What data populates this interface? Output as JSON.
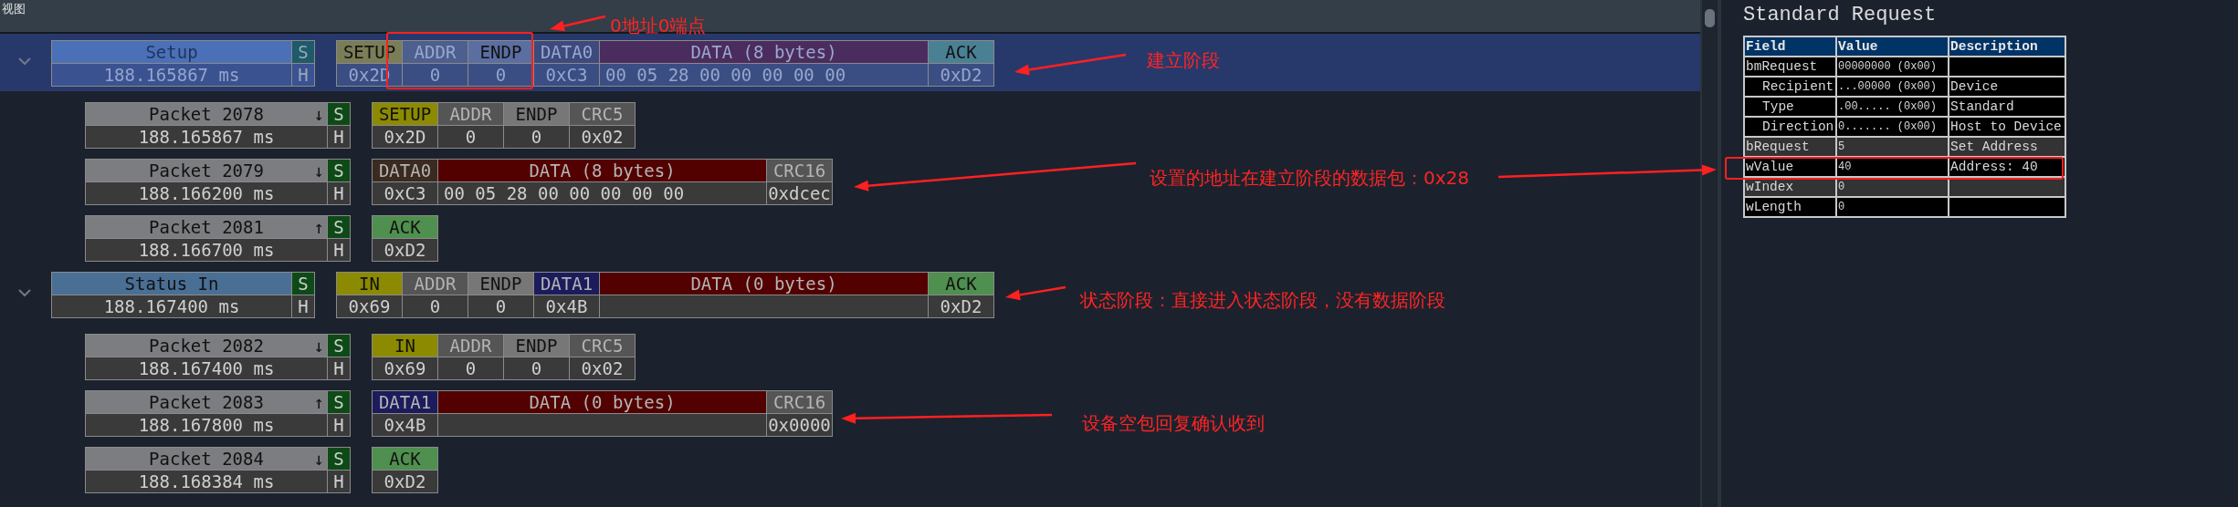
{
  "title_bar": {
    "title": "视图"
  },
  "transactions": [
    {
      "name": "Setup",
      "time": "188.165867 ms",
      "flag_top": "S",
      "flag_bottom": "H",
      "selected": true,
      "expanded": true,
      "fields": [
        {
          "label": "SETUP",
          "value": "0x2D",
          "kind": "pid",
          "color": "#7b7d57"
        },
        {
          "label": "ADDR",
          "value": "0",
          "kind": "addr",
          "color": "#4d5f8e"
        },
        {
          "label": "ENDP",
          "value": "0",
          "kind": "endp",
          "color": "#5b6ea2"
        },
        {
          "label": "DATA0",
          "value": "0xC3",
          "kind": "pid",
          "color": "#3d4a7e"
        },
        {
          "label": "DATA (8 bytes)",
          "value": "00 05 28 00 00 00 00 00",
          "kind": "data",
          "color": "#4b2c5f"
        },
        {
          "label": "ACK",
          "value": "0xD2",
          "kind": "pid",
          "color": "#4a8094"
        }
      ],
      "packets": [
        {
          "name": "Packet 2078",
          "direction": "↓",
          "time": "188.165867 ms",
          "flag_top": "S",
          "flag_bottom": "H",
          "fields": [
            {
              "label": "SETUP",
              "value": "0x2D",
              "kind": "pid",
              "color": "#8c8a00"
            },
            {
              "label": "ADDR",
              "value": "0",
              "kind": "addr",
              "color": "#555555"
            },
            {
              "label": "ENDP",
              "value": "0",
              "kind": "endp",
              "color": "#777777"
            },
            {
              "label": "CRC5",
              "value": "0x02",
              "kind": "crc",
              "color": "#555555"
            }
          ]
        },
        {
          "name": "Packet 2079",
          "direction": "↓",
          "time": "188.166200 ms",
          "flag_top": "S",
          "flag_bottom": "H",
          "fields": [
            {
              "label": "DATA0",
              "value": "0xC3",
              "kind": "pid",
              "color": "#3b2a20"
            },
            {
              "label": "DATA (8 bytes)",
              "value": "00 05 28 00 00 00 00 00",
              "kind": "data",
              "color": "#520000"
            },
            {
              "label": "CRC16",
              "value": "0xdcec",
              "kind": "crc",
              "color": "#555555"
            }
          ]
        },
        {
          "name": "Packet 2081",
          "direction": "↑",
          "time": "188.166700 ms",
          "flag_top": "S",
          "flag_bottom": "H",
          "fields": [
            {
              "label": "ACK",
              "value": "0xD2",
              "kind": "pid",
              "color": "#4f8f4f"
            }
          ]
        }
      ]
    },
    {
      "name": "Status In",
      "time": "188.167400 ms",
      "flag_top": "S",
      "flag_bottom": "H",
      "selected": false,
      "expanded": true,
      "fields": [
        {
          "label": "IN",
          "value": "0x69",
          "kind": "pid",
          "color": "#8c8a00"
        },
        {
          "label": "ADDR",
          "value": "0",
          "kind": "addr",
          "color": "#555555"
        },
        {
          "label": "ENDP",
          "value": "0",
          "kind": "endp",
          "color": "#777777"
        },
        {
          "label": "DATA1",
          "value": "0x4B",
          "kind": "pid",
          "color": "#1c1c5c"
        },
        {
          "label": "DATA (0 bytes)",
          "kind": "data",
          "color": "#520000"
        },
        {
          "label": "ACK",
          "value": "0xD2",
          "kind": "pid",
          "color": "#4f8f4f"
        }
      ],
      "packets": [
        {
          "name": "Packet 2082",
          "direction": "↓",
          "time": "188.167400 ms",
          "flag_top": "S",
          "flag_bottom": "H",
          "fields": [
            {
              "label": "IN",
              "value": "0x69",
              "kind": "pid",
              "color": "#8c8a00"
            },
            {
              "label": "ADDR",
              "value": "0",
              "kind": "addr",
              "color": "#555555"
            },
            {
              "label": "ENDP",
              "value": "0",
              "kind": "endp",
              "color": "#777777"
            },
            {
              "label": "CRC5",
              "value": "0x02",
              "kind": "crc",
              "color": "#555555"
            }
          ]
        },
        {
          "name": "Packet 2083",
          "direction": "↑",
          "time": "188.167800 ms",
          "flag_top": "S",
          "flag_bottom": "H",
          "fields": [
            {
              "label": "DATA1",
              "value": "0x4B",
              "kind": "pid",
              "color": "#1c1c5c"
            },
            {
              "label": "DATA (0 bytes)",
              "kind": "data",
              "color": "#520000"
            },
            {
              "label": "CRC16",
              "value": "0x0000",
              "kind": "crc",
              "color": "#555555"
            }
          ]
        },
        {
          "name": "Packet 2084",
          "direction": "↓",
          "time": "188.168384 ms",
          "flag_top": "S",
          "flag_bottom": "H",
          "fields": [
            {
              "label": "ACK",
              "value": "0xD2",
              "kind": "pid",
              "color": "#4f8f4f"
            }
          ]
        }
      ]
    }
  ],
  "details": {
    "title": "Standard Request",
    "columns": [
      "Field",
      "Value",
      "Description"
    ],
    "rows": [
      {
        "field": "bmRequest",
        "value": "00000000 (0x00)",
        "children": [
          {
            "field": "Recipient",
            "value": "...00000 (0x00)",
            "description": "Device"
          },
          {
            "field": "Type",
            "value": ".00..... (0x00)",
            "description": "Standard"
          },
          {
            "field": "Direction",
            "value": "0....... (0x00)",
            "description": "Host to Device"
          }
        ]
      },
      {
        "field": "bRequest",
        "value": "5",
        "description": "Set Address"
      },
      {
        "field": "wValue",
        "value": "40",
        "description": "Address: 40"
      },
      {
        "field": "wIndex",
        "value": "0"
      },
      {
        "field": "wLength",
        "value": "0"
      }
    ]
  },
  "annotations": [
    {
      "text": "0地址0端点"
    },
    {
      "text": "建立阶段"
    },
    {
      "text": "设置的地址在建立阶段的数据包：0x28"
    },
    {
      "text": "状态阶段：直接进入状态阶段，没有数据阶段"
    },
    {
      "text": "设备空包回复确认收到"
    }
  ]
}
